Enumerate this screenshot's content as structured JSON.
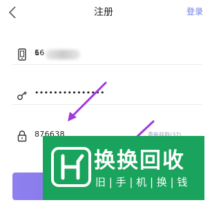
{
  "header": {
    "title": "注册",
    "login_label": "登录",
    "back_icon": "chevron-left-icon"
  },
  "form": {
    "phone": {
      "icon": "phone-icon",
      "prefix": "16",
      "suffix": "6"
    },
    "password": {
      "icon": "key-icon",
      "masked_value": "•••••••••••••••"
    },
    "code": {
      "icon": "lock-icon",
      "value": "876638",
      "resend_label": "重新获取(37)"
    }
  },
  "watermark": {
    "title": "换换回收",
    "subtitle": "旧 | 手 | 机 | 换 | 钱",
    "logo_icon": "h-logo-icon"
  },
  "colors": {
    "accent": "#6c7de8",
    "button": "#7e72ea",
    "arrow": "#a03ad8",
    "watermark_bg": "#1aa35c"
  }
}
